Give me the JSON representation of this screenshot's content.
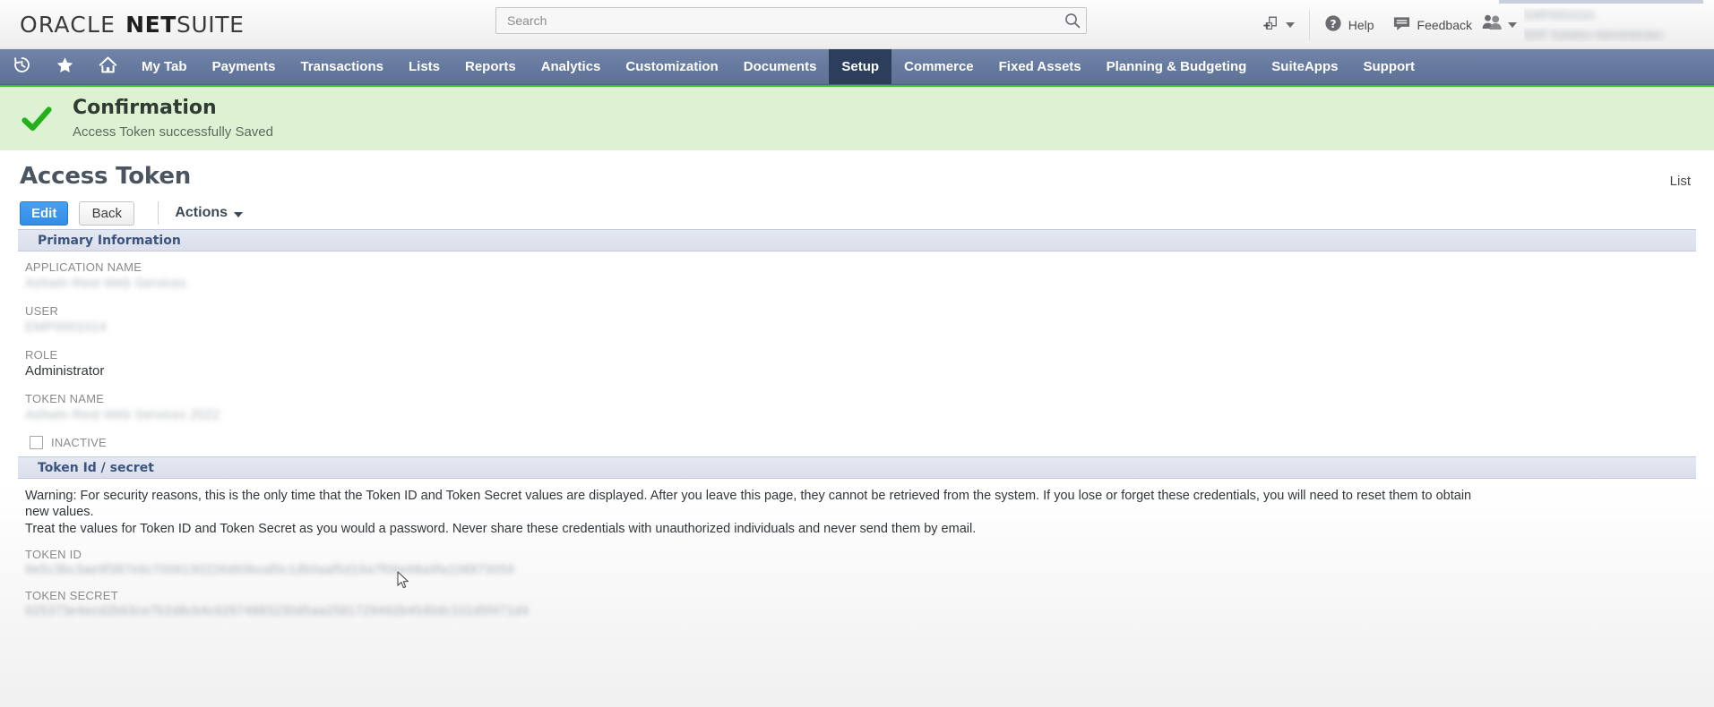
{
  "header": {
    "brand": {
      "oracle": "ORACLE",
      "net": "NET",
      "suite": "SUITE"
    },
    "search": {
      "placeholder": "Search",
      "value": "",
      "icon": "search-icon"
    },
    "quick_add": {
      "icon": "add-record-icon"
    },
    "help": {
      "label": "Help",
      "icon": "help-icon"
    },
    "feedback": {
      "label": "Feedback",
      "icon": "feedback-icon"
    },
    "user": {
      "icon": "users-icon",
      "name": "EMP0001014",
      "role": "BSP Solution  Administrator"
    }
  },
  "nav": {
    "icons": [
      {
        "name": "recent-records-icon"
      },
      {
        "name": "shortcuts-star-icon"
      },
      {
        "name": "home-icon"
      }
    ],
    "items": [
      {
        "label": "My Tab",
        "active": false
      },
      {
        "label": "Payments",
        "active": false
      },
      {
        "label": "Transactions",
        "active": false
      },
      {
        "label": "Lists",
        "active": false
      },
      {
        "label": "Reports",
        "active": false
      },
      {
        "label": "Analytics",
        "active": false
      },
      {
        "label": "Customization",
        "active": false
      },
      {
        "label": "Documents",
        "active": false
      },
      {
        "label": "Setup",
        "active": true
      },
      {
        "label": "Commerce",
        "active": false
      },
      {
        "label": "Fixed Assets",
        "active": false
      },
      {
        "label": "Planning & Budgeting",
        "active": false
      },
      {
        "label": "SuiteApps",
        "active": false
      },
      {
        "label": "Support",
        "active": false
      }
    ]
  },
  "confirmation": {
    "icon": "green-check-icon",
    "title": "Confirmation",
    "message": "Access Token successfully Saved",
    "color": "#3bbf2a",
    "background": "#ddf2d2"
  },
  "page": {
    "title": "Access Token",
    "list_link": "List",
    "toolbar": {
      "edit_label": "Edit",
      "back_label": "Back",
      "actions_label": "Actions"
    }
  },
  "primary_information": {
    "section_title": "Primary Information",
    "fields": [
      {
        "label": "APPLICATION NAME",
        "value": "Ashwin Rest Web Services",
        "redacted": true
      },
      {
        "label": "USER",
        "value": "EMP0001014",
        "redacted": true
      },
      {
        "label": "ROLE",
        "value": "Administrator",
        "redacted": false
      },
      {
        "label": "TOKEN NAME",
        "value": "Ashwin Rest Web Services 2022",
        "redacted": true
      }
    ],
    "inactive_checkbox": {
      "label": "INACTIVE",
      "checked": false
    }
  },
  "token_section": {
    "section_title": "Token Id / secret",
    "warning_line_1": "Warning: For security reasons, this is the only time that the Token ID and Token Secret values are displayed. After you leave this page, they cannot be retrieved from the system. If you lose or forget these credentials, you will need to reset them to obtain",
    "warning_line_2": "new values.",
    "warning_line_3": "Treat the values for Token ID and Token Secret as you would a password. Never share these credentials with unauthorized individuals and never send them by email.",
    "fields": [
      {
        "label": "TOKEN ID",
        "value": "9e5c3bc3ae9f387e6c7006130226d60bcaf0c1db0aaf5d19a7f06e68a9fa108873059",
        "redacted": true
      },
      {
        "label": "TOKEN SECRET",
        "value": "925373e4ecd2b63ce7b2d8cb4c62674883230d5aa2581729492b45d0dc101d5f471d4",
        "redacted": true
      }
    ]
  },
  "colors": {
    "nav_bg": "#65789e",
    "nav_active": "#2c3e5c",
    "accent_blue": "#2f8de8",
    "section_header_bg": "#dadfeb",
    "section_header_text": "#3c5480",
    "confirm_green": "#3bbf2a"
  }
}
